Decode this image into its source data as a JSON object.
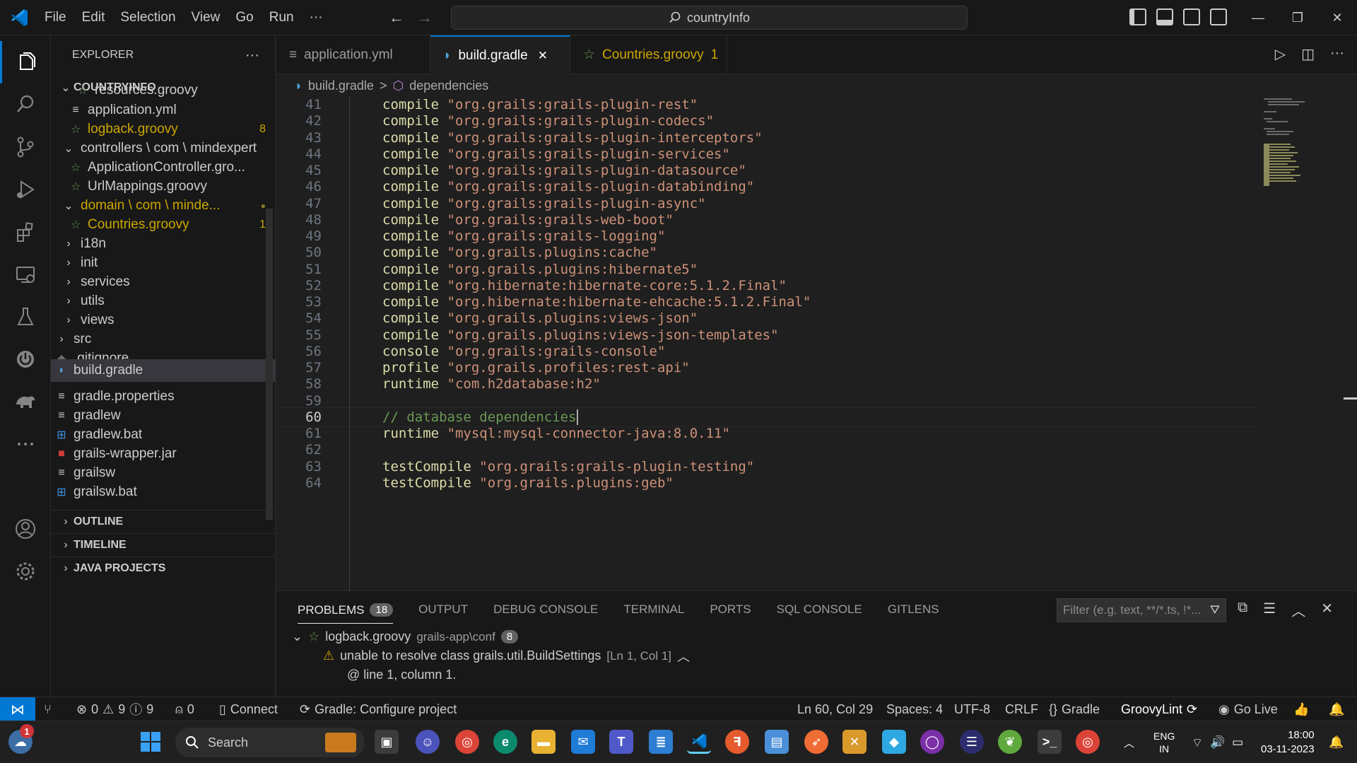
{
  "titlebar": {
    "menu": [
      "File",
      "Edit",
      "Selection",
      "View",
      "Go",
      "Run",
      "···"
    ],
    "search": "countryInfo"
  },
  "sidebar": {
    "header": "EXPLORER",
    "more": "···",
    "root": "COUNTRYINFO",
    "items": [
      {
        "label": "resources.groovy",
        "icon": "groovy-icon"
      },
      {
        "label": "application.yml",
        "icon": "file-lines-icon"
      },
      {
        "label": "logback.groovy",
        "icon": "groovy-icon",
        "badge": "8"
      },
      {
        "label": "controllers \\ com \\ mindexpert",
        "icon": "chevron-down-icon"
      },
      {
        "label": "ApplicationController.gro...",
        "icon": "groovy-icon"
      },
      {
        "label": "UrlMappings.groovy",
        "icon": "groovy-icon"
      },
      {
        "label": "domain \\ com \\ minde...",
        "icon": "chevron-down-icon",
        "badge": "●"
      },
      {
        "label": "Countries.groovy",
        "icon": "groovy-icon",
        "badge": "1"
      },
      {
        "label": "i18n",
        "icon": "chevron-right-icon"
      },
      {
        "label": "init",
        "icon": "chevron-right-icon"
      },
      {
        "label": "services",
        "icon": "chevron-right-icon"
      },
      {
        "label": "utils",
        "icon": "chevron-right-icon"
      },
      {
        "label": "views",
        "icon": "chevron-right-icon"
      },
      {
        "label": "src",
        "icon": "chevron-right-icon"
      },
      {
        "label": ".gitignore",
        "icon": "git-icon"
      },
      {
        "label": "build.gradle",
        "icon": "gradle-icon"
      },
      {
        "label": "gradle.properties",
        "icon": "file-lines-icon"
      },
      {
        "label": "gradlew",
        "icon": "file-lines-icon"
      },
      {
        "label": "gradlew.bat",
        "icon": "windows-icon"
      },
      {
        "label": "grails-wrapper.jar",
        "icon": "jar-icon"
      },
      {
        "label": "grailsw",
        "icon": "file-lines-icon"
      },
      {
        "label": "grailsw.bat",
        "icon": "windows-icon"
      }
    ],
    "sections": [
      "OUTLINE",
      "TIMELINE",
      "JAVA PROJECTS"
    ]
  },
  "tabs": [
    {
      "label": "application.yml",
      "icon": "file-lines-icon"
    },
    {
      "label": "build.gradle",
      "icon": "gradle-icon",
      "close": "✕"
    },
    {
      "label": "Countries.groovy",
      "badge": "1",
      "icon": "groovy-icon"
    }
  ],
  "breadcrumb": {
    "file": "build.gradle",
    "sep": ">",
    "symbol": "dependencies"
  },
  "editor": {
    "lines": [
      {
        "n": "41",
        "kw": "compile",
        "str": "\"org.grails:grails-plugin-rest\""
      },
      {
        "n": "42",
        "kw": "compile",
        "str": "\"org.grails:grails-plugin-codecs\""
      },
      {
        "n": "43",
        "kw": "compile",
        "str": "\"org.grails:grails-plugin-interceptors\""
      },
      {
        "n": "44",
        "kw": "compile",
        "str": "\"org.grails:grails-plugin-services\""
      },
      {
        "n": "45",
        "kw": "compile",
        "str": "\"org.grails:grails-plugin-datasource\""
      },
      {
        "n": "46",
        "kw": "compile",
        "str": "\"org.grails:grails-plugin-databinding\""
      },
      {
        "n": "47",
        "kw": "compile",
        "str": "\"org.grails:grails-plugin-async\""
      },
      {
        "n": "48",
        "kw": "compile",
        "str": "\"org.grails:grails-web-boot\""
      },
      {
        "n": "49",
        "kw": "compile",
        "str": "\"org.grails:grails-logging\""
      },
      {
        "n": "50",
        "kw": "compile",
        "str": "\"org.grails.plugins:cache\""
      },
      {
        "n": "51",
        "kw": "compile",
        "str": "\"org.grails.plugins:hibernate5\""
      },
      {
        "n": "52",
        "kw": "compile",
        "str": "\"org.hibernate:hibernate-core:5.1.2.Final\""
      },
      {
        "n": "53",
        "kw": "compile",
        "str": "\"org.hibernate:hibernate-ehcache:5.1.2.Final\""
      },
      {
        "n": "54",
        "kw": "compile",
        "str": "\"org.grails.plugins:views-json\""
      },
      {
        "n": "55",
        "kw": "compile",
        "str": "\"org.grails.plugins:views-json-templates\""
      },
      {
        "n": "56",
        "kw": "console",
        "str": "\"org.grails:grails-console\""
      },
      {
        "n": "57",
        "kw": "profile",
        "str": "\"org.grails.profiles:rest-api\""
      },
      {
        "n": "58",
        "kw": "runtime",
        "str": "\"com.h2database:h2\""
      },
      {
        "n": "59",
        "kw": "",
        "str": ""
      },
      {
        "n": "60",
        "comment": "// database dependencies"
      },
      {
        "n": "61",
        "kw": "runtime",
        "str": "\"mysql:mysql-connector-java:8.0.11\""
      },
      {
        "n": "62",
        "kw": "",
        "str": ""
      },
      {
        "n": "63",
        "kw": "testCompile",
        "str": "\"org.grails:grails-plugin-testing\""
      },
      {
        "n": "64",
        "kw": "testCompile",
        "str": "\"org.grails.plugins:geb\""
      }
    ]
  },
  "panel": {
    "tabs": [
      "PROBLEMS",
      "OUTPUT",
      "DEBUG CONSOLE",
      "TERMINAL",
      "PORTS",
      "SQL CONSOLE",
      "GITLENS"
    ],
    "problems_count": "18",
    "filter_placeholder": "Filter (e.g. text, **/*.ts, !*...",
    "file": "logback.groovy",
    "file_path": "grails-app\\conf",
    "file_count": "8",
    "problem_text": "unable to resolve class grails.util.BuildSettings",
    "problem_loc": "[Ln 1, Col 1]",
    "problem_detail": "@ line 1, column 1."
  },
  "status": {
    "errors": "0",
    "warnings": "9",
    "infos": "9",
    "ports": "0",
    "connect": "Connect",
    "gradle_task": "Gradle: Configure project",
    "position": "Ln 60, Col 29",
    "spaces": "Spaces: 4",
    "encoding": "UTF-8",
    "eol": "CRLF",
    "language": "Gradle",
    "lint": "GroovyLint",
    "golive": "Go Live"
  },
  "taskbar": {
    "search": "Search",
    "lang": "ENG",
    "region": "IN",
    "time": "18:00",
    "date": "03-11-2023",
    "notif_badge": "1"
  },
  "colors": {
    "accent": "#0078d4",
    "keyword": "#dcdcaa",
    "string": "#ce9178",
    "comment": "#6a9955",
    "warning": "#cca700"
  }
}
